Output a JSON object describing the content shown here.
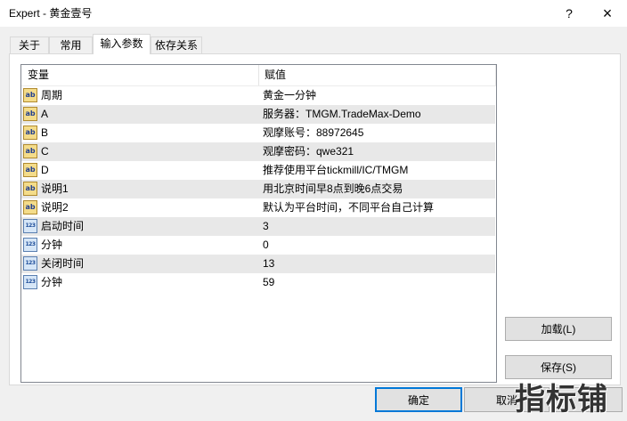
{
  "window": {
    "title": "Expert - 黄金壹号",
    "help_label": "?",
    "close_label": "×"
  },
  "tabs": [
    {
      "label": "关于",
      "selected": false
    },
    {
      "label": "常用",
      "selected": false
    },
    {
      "label": "输入参数",
      "selected": true
    },
    {
      "label": "依存关系",
      "selected": false
    }
  ],
  "inputs_table": {
    "headers": {
      "variable": "变量",
      "value": "赋值"
    },
    "rows": [
      {
        "icon": "string-type-icon",
        "icon_text": "ab",
        "name": "周期",
        "value": "黄金一分钟"
      },
      {
        "icon": "string-type-icon",
        "icon_text": "ab",
        "name": "A",
        "value": "服务器：TMGM.TradeMax-Demo"
      },
      {
        "icon": "string-type-icon",
        "icon_text": "ab",
        "name": "B",
        "value": "观摩账号：88972645"
      },
      {
        "icon": "string-type-icon",
        "icon_text": "ab",
        "name": "C",
        "value": "观摩密码：qwe321"
      },
      {
        "icon": "string-type-icon",
        "icon_text": "ab",
        "name": "D",
        "value": "推荐使用平台tickmill/IC/TMGM"
      },
      {
        "icon": "string-type-icon",
        "icon_text": "ab",
        "name": "说明1",
        "value": "用北京时间早8点到晚6点交易"
      },
      {
        "icon": "string-type-icon",
        "icon_text": "ab",
        "name": "说明2",
        "value": "默认为平台时间，不同平台自己计算"
      },
      {
        "icon": "integer-type-icon",
        "icon_text": "123",
        "name": "启动时间",
        "value": "3"
      },
      {
        "icon": "integer-type-icon",
        "icon_text": "123",
        "name": "分钟",
        "value": "0"
      },
      {
        "icon": "integer-type-icon",
        "icon_text": "123",
        "name": "关闭时间",
        "value": "13"
      },
      {
        "icon": "integer-type-icon",
        "icon_text": "123",
        "name": "分钟",
        "value": "59"
      }
    ]
  },
  "side_buttons": {
    "load_label": "加载(L)",
    "save_label": "保存(S)"
  },
  "footer_buttons": {
    "ok_label": "确定",
    "cancel_label": "取消"
  },
  "watermark": "指标铺",
  "colors": {
    "focus_border": "#0078d7",
    "row_alt": "#e8e8e8",
    "string_icon": "#f4dc8a",
    "integer_icon": "#d6e6f7"
  }
}
